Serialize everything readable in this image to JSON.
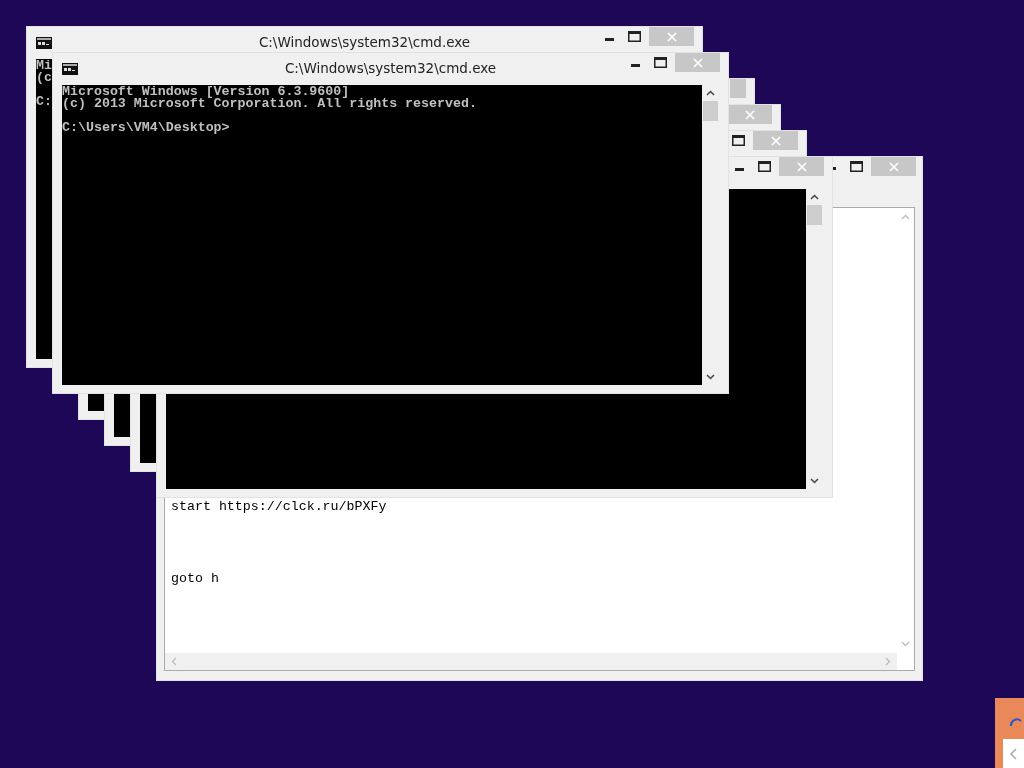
{
  "desktop": {
    "windows": [
      {
        "kind": "console",
        "title": "C:\\Windows\\system32\\cmd.exe",
        "lines": [
          "Mi",
          "(c",
          "C:"
        ]
      },
      {
        "kind": "console",
        "title": "C:\\Windows\\system32\\cmd.exe",
        "lines": [
          "Microsoft Windows [Version 6.3.9600]",
          "(c) 2013 Microsoft Corporation. All rights reserved.",
          "C:\\Users\\VM4\\Desktop>"
        ]
      },
      {
        "kind": "console"
      },
      {
        "kind": "console"
      },
      {
        "kind": "console"
      },
      {
        "kind": "console"
      },
      {
        "kind": "notepad",
        "lines": [
          "start https://clck.ru/bPXFy",
          "goto h"
        ]
      }
    ]
  },
  "corner_panel": {
    "kind": "notification"
  }
}
